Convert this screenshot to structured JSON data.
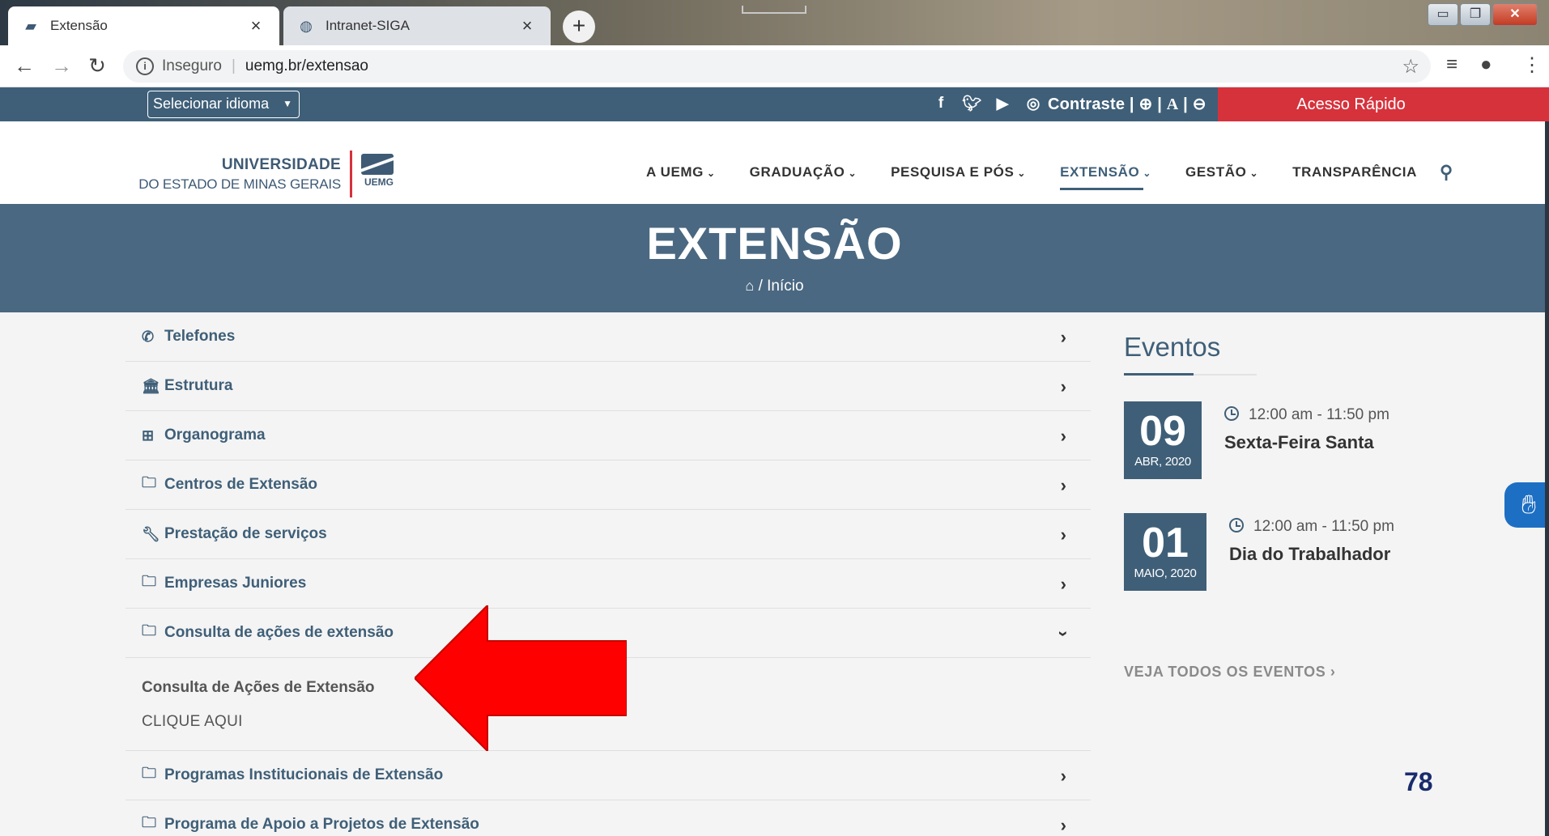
{
  "browser": {
    "tabs": [
      {
        "label": "Extensão",
        "close": "×"
      },
      {
        "label": "Intranet-SIGA",
        "close": "×"
      }
    ],
    "new_tab": "+",
    "address": {
      "security": "Inseguro",
      "url": "uemg.br/extensao"
    }
  },
  "topbar": {
    "language_select": "Selecionar idioma",
    "contrast": "Contraste | 🔍︎ | A | 🔍︎",
    "contrast_label": "Contraste |",
    "font_a": "A",
    "quick_access": "Acesso Rápido"
  },
  "logo": {
    "line1": "UNIVERSIDADE",
    "line2": "DO ESTADO DE MINAS GERAIS",
    "mark": "UEMG"
  },
  "nav": {
    "items": [
      {
        "label": "A UEMG"
      },
      {
        "label": "GRADUAÇÃO"
      },
      {
        "label": "PESQUISA E PÓS"
      },
      {
        "label": "EXTENSÃO"
      },
      {
        "label": "GESTÃO"
      },
      {
        "label": "TRANSPARÊNCIA"
      }
    ]
  },
  "banner": {
    "title": "EXTENSÃO",
    "breadcrumb_sep": "/",
    "breadcrumb_current": "Início"
  },
  "accordion": {
    "items": [
      {
        "label": "Telefones",
        "icon": "phone-icon"
      },
      {
        "label": "Estrutura",
        "icon": "bank-icon"
      },
      {
        "label": "Organograma",
        "icon": "sitemap-icon"
      },
      {
        "label": "Centros de Extensão",
        "icon": "folder-icon"
      },
      {
        "label": "Prestação de serviços",
        "icon": "wrench-icon"
      },
      {
        "label": "Empresas Juniores",
        "icon": "folder-icon"
      },
      {
        "label": "Consulta de ações de extensão",
        "icon": "folder-icon"
      },
      {
        "label": "Programas Institucionais de Extensão",
        "icon": "folder-icon"
      },
      {
        "label": "Programa de Apoio a Projetos de Extensão",
        "icon": "folder-icon"
      }
    ],
    "expanded": {
      "title": "Consulta de Ações de Extensão",
      "link": "CLIQUE AQUI"
    }
  },
  "events": {
    "heading": "Eventos",
    "items": [
      {
        "day": "09",
        "month": "ABR, 2020",
        "time": "12:00 am - 11:50 pm",
        "title": "Sexta-Feira Santa"
      },
      {
        "day": "01",
        "month": "MAIO, 2020",
        "time": "12:00 am - 11:50 pm",
        "title": "Dia do Trabalhador"
      }
    ],
    "see_all": "VEJA TODOS OS EVENTOS ›"
  },
  "page_number": "78",
  "colors": {
    "primary": "#3f5f78",
    "accent": "#d6323c",
    "arrow": "#ff0000"
  }
}
